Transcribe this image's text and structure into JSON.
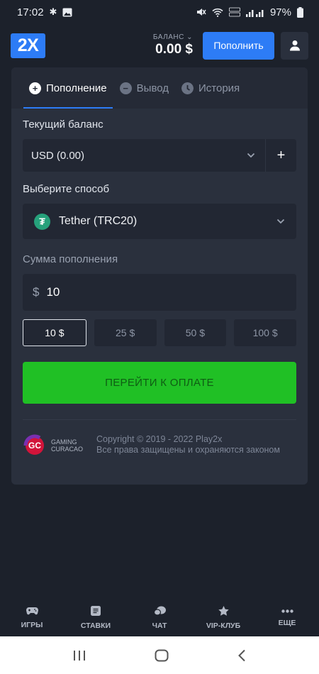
{
  "status_bar": {
    "time": "17:02",
    "battery": "97%"
  },
  "header": {
    "logo": "2X",
    "balance_label": "БАЛАНС",
    "balance_value": "0.00 $",
    "deposit_button": "Пополнить"
  },
  "tabs": [
    {
      "label": "Пополнение",
      "icon": "plus-circle-icon",
      "active": true
    },
    {
      "label": "Вывод",
      "icon": "minus-circle-icon",
      "active": false
    },
    {
      "label": "История",
      "icon": "clock-icon",
      "active": false
    }
  ],
  "form": {
    "balance_label": "Текущий баланс",
    "balance_select": "USD (0.00)",
    "method_label": "Выберите способ",
    "method_select": "Tether (TRC20)",
    "amount_label": "Сумма пополнения",
    "amount_currency": "$",
    "amount_value": "10",
    "presets": [
      "10 $",
      "25 $",
      "50 $",
      "100 $"
    ],
    "selected_preset": "10 $",
    "pay_button": "ПЕРЕЙТИ К ОПЛАТЕ"
  },
  "footer": {
    "gc_mark": "GC",
    "gc_line1": "GAMING",
    "gc_line2": "CURACAO",
    "copyright": "Copyright © 2019 - 2022 Play2x",
    "rights": "Все права защищены и охраняются законом"
  },
  "bottom_nav": [
    {
      "label": "ИГРЫ",
      "icon": "gamepad-icon"
    },
    {
      "label": "СТАВКИ",
      "icon": "ticket-icon"
    },
    {
      "label": "ЧАТ",
      "icon": "chat-icon"
    },
    {
      "label": "VIP-КЛУБ",
      "icon": "star-icon"
    },
    {
      "label": "ЕЩЕ",
      "icon": "more-icon"
    }
  ],
  "colors": {
    "accent": "#2d7cf6",
    "pay_green": "#20c025",
    "background": "#1c212b",
    "card": "#2a303d"
  }
}
